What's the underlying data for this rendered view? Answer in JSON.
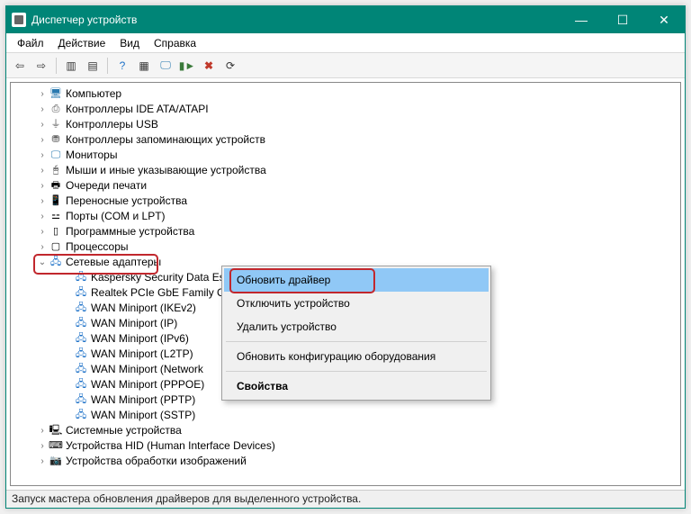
{
  "window": {
    "title": "Диспетчер устройств"
  },
  "menu": {
    "file": "Файл",
    "action": "Действие",
    "view": "Вид",
    "help": "Справка"
  },
  "tree": {
    "computer": "Компьютер",
    "ide": "Контроллеры IDE ATA/ATAPI",
    "usb": "Контроллеры USB",
    "storage": "Контроллеры запоминающих устройств",
    "monitors": "Мониторы",
    "hid_pointing": "Мыши и иные указывающие устройства",
    "print_queues": "Очереди печати",
    "portable": "Переносные устройства",
    "ports": "Порты (COM и LPT)",
    "software": "Программные устройства",
    "processors": "Процессоры",
    "netadapters": "Сетевые адаптеры",
    "children": {
      "kaspersky": "Kaspersky Security Data Escort Adapter",
      "realtek": "Realtek PCIe GbE Family C",
      "wan_ikev2": "WAN Miniport (IKEv2)",
      "wan_ip": "WAN Miniport (IP)",
      "wan_ipv6": "WAN Miniport (IPv6)",
      "wan_l2tp": "WAN Miniport (L2TP)",
      "wan_network": "WAN Miniport (Network",
      "wan_pppoe": "WAN Miniport (PPPOE)",
      "wan_pptp": "WAN Miniport (PPTP)",
      "wan_sstp": "WAN Miniport (SSTP)"
    },
    "system": "Системные устройства",
    "hid": "Устройства HID (Human Interface Devices)",
    "imaging": "Устройства обработки изображений"
  },
  "context_menu": {
    "update": "Обновить драйвер",
    "disable": "Отключить устройство",
    "uninstall": "Удалить устройство",
    "scan": "Обновить конфигурацию оборудования",
    "properties": "Свойства"
  },
  "statusbar": "Запуск мастера обновления драйверов для выделенного устройства."
}
